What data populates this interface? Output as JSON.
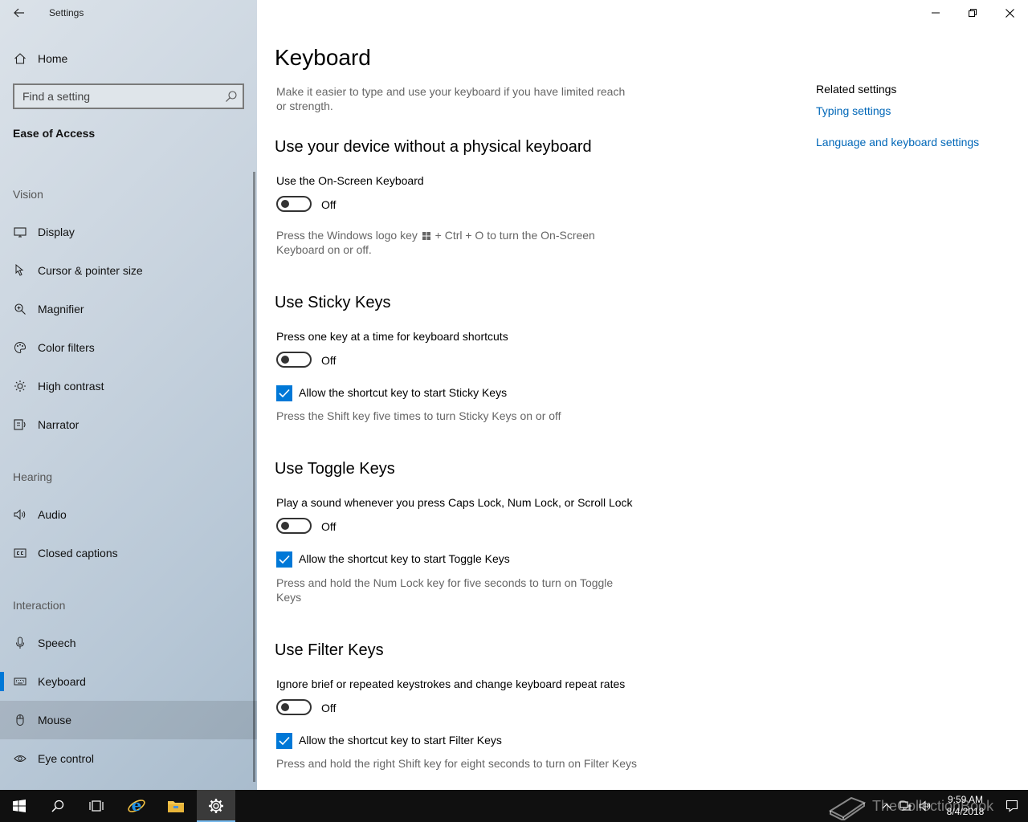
{
  "window": {
    "title": "Settings"
  },
  "sidebar": {
    "home_label": "Home",
    "search_placeholder": "Find a setting",
    "section_title": "Ease of Access",
    "groups": {
      "vision": "Vision",
      "hearing": "Hearing",
      "interaction": "Interaction"
    },
    "items": {
      "display": "Display",
      "cursor": "Cursor & pointer size",
      "magnifier": "Magnifier",
      "color_filters": "Color filters",
      "high_contrast": "High contrast",
      "narrator": "Narrator",
      "audio": "Audio",
      "closed_captions": "Closed captions",
      "speech": "Speech",
      "keyboard": "Keyboard",
      "mouse": "Mouse",
      "eye_control": "Eye control"
    },
    "selected_item": "Keyboard",
    "accent_color": "#0078d7"
  },
  "main": {
    "title": "Keyboard",
    "intro": "Make it easier to type and use your keyboard if you have limited reach or strength.",
    "onscreen": {
      "heading": "Use your device without a physical keyboard",
      "label": "Use the On-Screen Keyboard",
      "state": "Off",
      "hint_before": "Press the Windows logo key",
      "hint_after": "+ Ctrl + O to turn the On-Screen Keyboard on or off."
    },
    "sticky": {
      "heading": "Use Sticky Keys",
      "label": "Press one key at a time for keyboard shortcuts",
      "state": "Off",
      "checkbox_label": "Allow the shortcut key to start Sticky Keys",
      "hint": "Press the Shift key five times to turn Sticky Keys on or off"
    },
    "toggle_keys": {
      "heading": "Use Toggle Keys",
      "label": "Play a sound whenever you press Caps Lock, Num Lock, or Scroll Lock",
      "state": "Off",
      "checkbox_label": "Allow the shortcut key to start Toggle Keys",
      "hint": "Press and hold the Num Lock key for five seconds to turn on Toggle Keys"
    },
    "filter": {
      "heading": "Use Filter Keys",
      "label": "Ignore brief or repeated keystrokes and change keyboard repeat rates",
      "state": "Off",
      "checkbox_label": "Allow the shortcut key to start Filter Keys",
      "hint": "Press and hold the right Shift key for eight seconds to turn on Filter Keys"
    },
    "related": {
      "title": "Related settings",
      "typing_link": "Typing settings",
      "language_link": "Language and keyboard settings"
    },
    "link_color": "#0067b8"
  },
  "taskbar": {
    "time": "9:59 AM",
    "date": "8/4/2018",
    "watermark": "TheCollectionBook"
  }
}
